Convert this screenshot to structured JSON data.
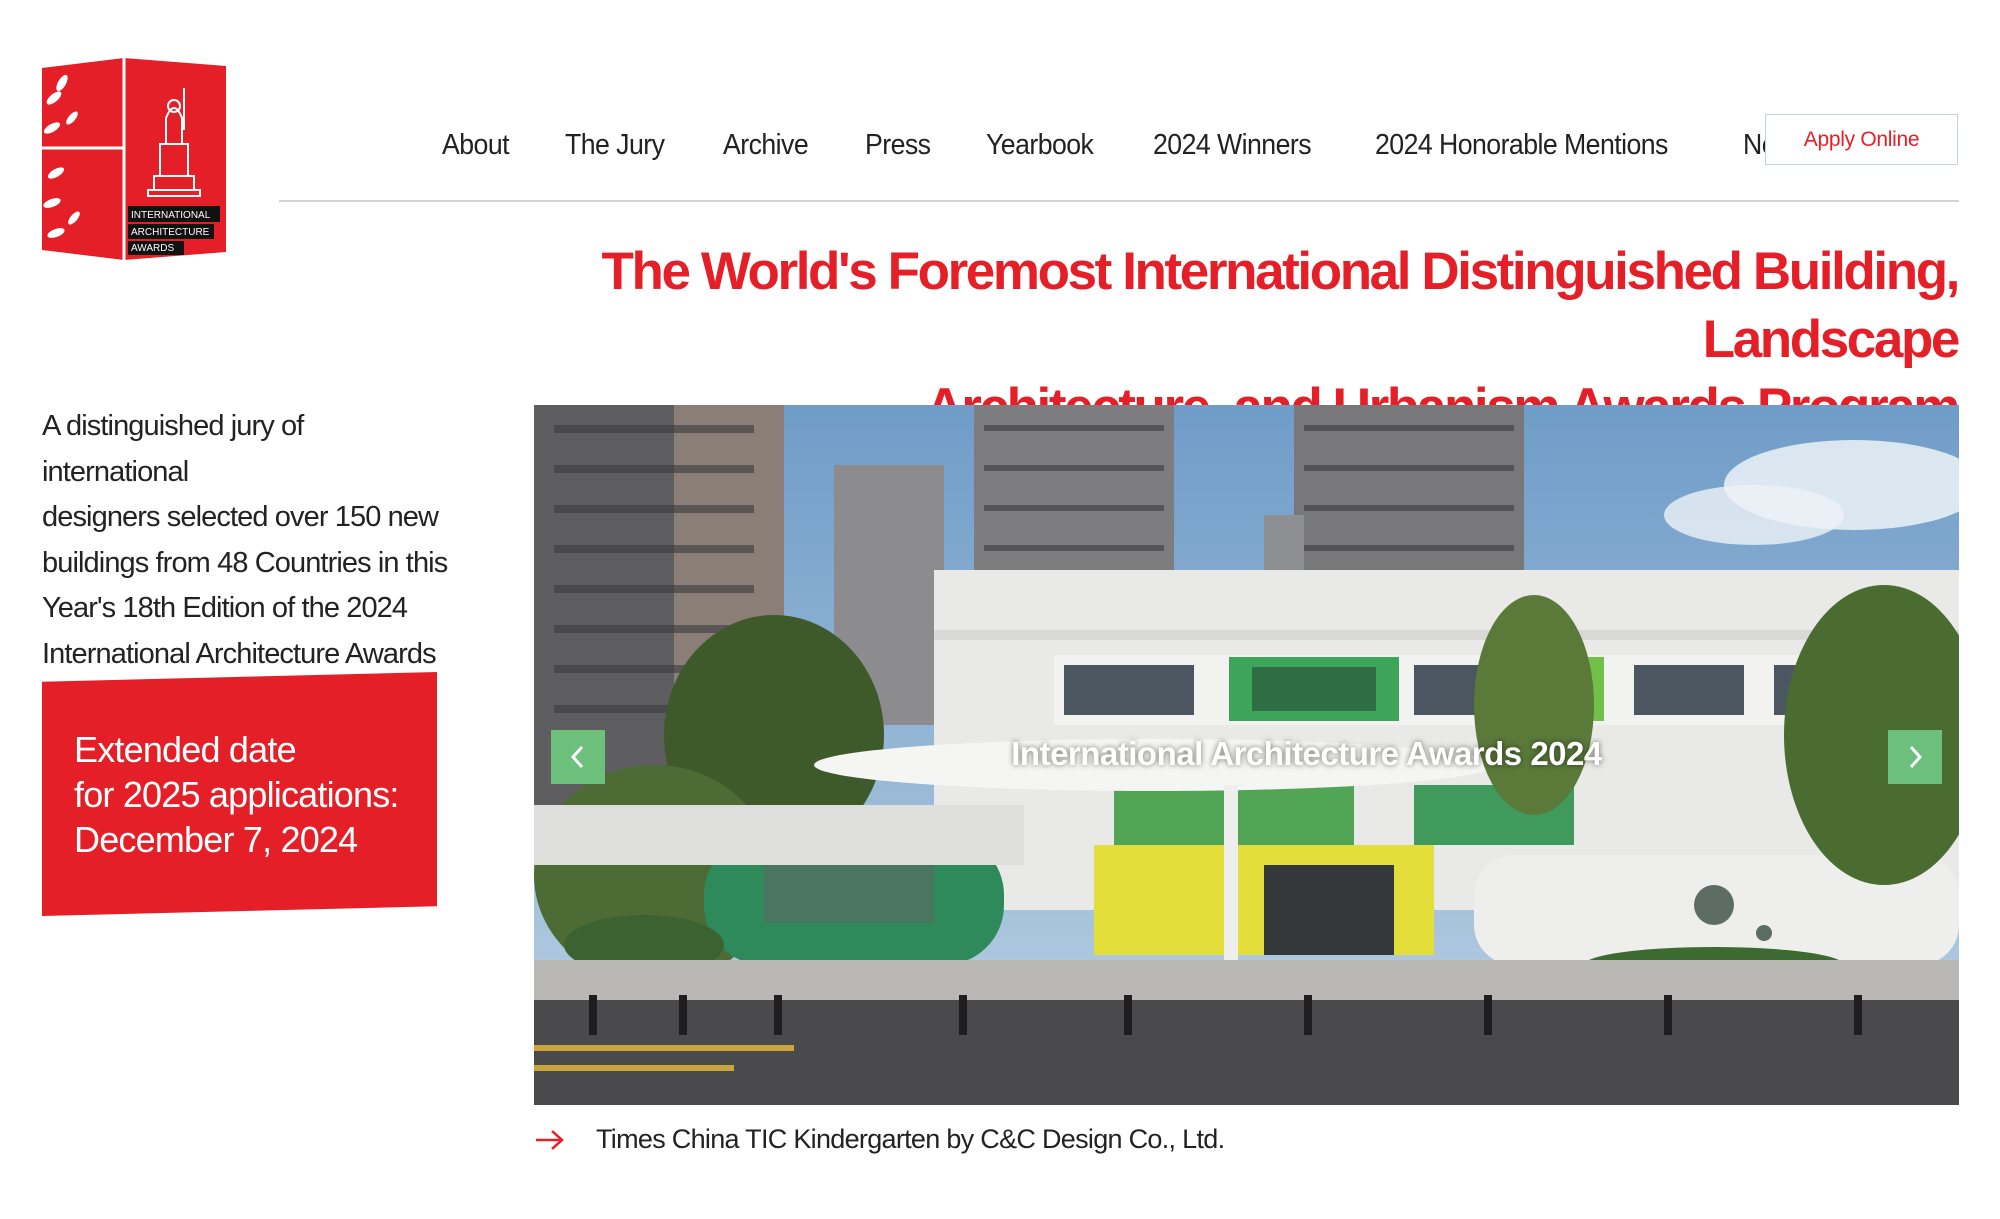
{
  "logo": {
    "lines": [
      "INTERNATIONAL",
      "ARCHITECTURE",
      "AWARDS"
    ],
    "brand_color": "#e51f27"
  },
  "nav": {
    "items": [
      {
        "label": "About"
      },
      {
        "label": "The Jury"
      },
      {
        "label": "Archive"
      },
      {
        "label": "Press"
      },
      {
        "label": "Yearbook"
      },
      {
        "label": "2024 Winners"
      },
      {
        "label": "2024 Honorable Mentions"
      },
      {
        "label": "News"
      }
    ],
    "apply_label": "Apply Online"
  },
  "headline": {
    "line1": "The World's Foremost International Distinguished Building, Landscape",
    "line2": "Architecture, and Urbanism Awards Program"
  },
  "intro": {
    "lines": [
      "A distinguished jury of international",
      "designers selected over 150 new",
      "buildings from 48 Countries in this",
      "Year's 18th Edition of the 2024",
      "International Architecture Awards"
    ]
  },
  "deadline": {
    "line1": "Extended date",
    "line2": "for 2025 applications:",
    "line3": "December 7, 2024"
  },
  "slider": {
    "title": "International Architecture Awards 2024",
    "prev_icon": "chevron-left-icon",
    "next_icon": "chevron-right-icon",
    "accent": "#6cc07c"
  },
  "caption": {
    "icon": "arrow-right-icon",
    "text": "Times China TIC Kindergarten by C&C Design Co., Ltd."
  }
}
